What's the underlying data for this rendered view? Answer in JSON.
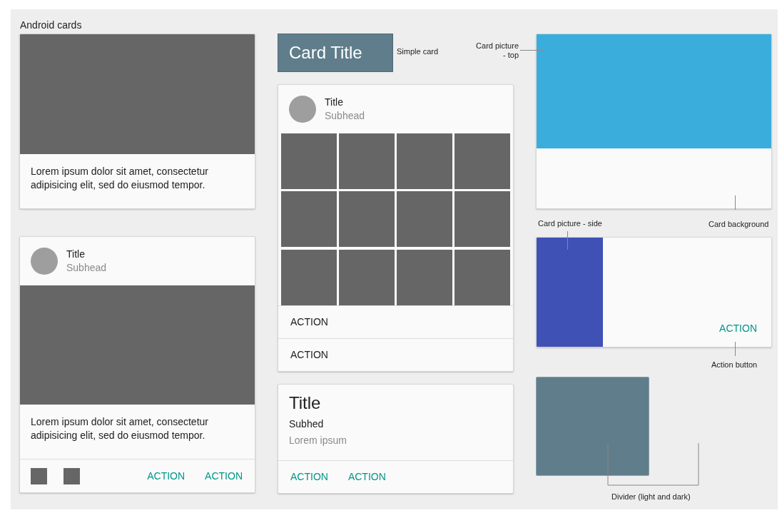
{
  "title": "Android cards",
  "column_1": {
    "text_card": {
      "text": "Lorem ipsum dolor sit amet, consectetur adipisicing elit, sed do eiusmod tempor."
    },
    "media_card": {
      "title": "Title",
      "subhead": "Subhead",
      "text": "Lorem ipsum dolor sit amet, consectetur adipisicing elit, sed do eiusmod tempor.",
      "actions": [
        "ACTION",
        "ACTION"
      ]
    }
  },
  "column_2": {
    "simple_card": {
      "title": "Card Title"
    },
    "grid_card": {
      "title": "Title",
      "subhead": "Subhead",
      "actions": [
        "ACTION",
        "ACTION"
      ]
    },
    "title_card": {
      "title": "Title",
      "subhead": "Subhed",
      "text": "Lorem ipsum",
      "actions": [
        "ACTION",
        "ACTION"
      ]
    }
  },
  "column_3": {
    "side_card": {
      "action": "ACTION"
    }
  },
  "annotations": [
    "Simple card",
    "Card picture - top",
    "Card picture - side",
    "Card background",
    "Action button",
    "Divider (light and dark)"
  ]
}
